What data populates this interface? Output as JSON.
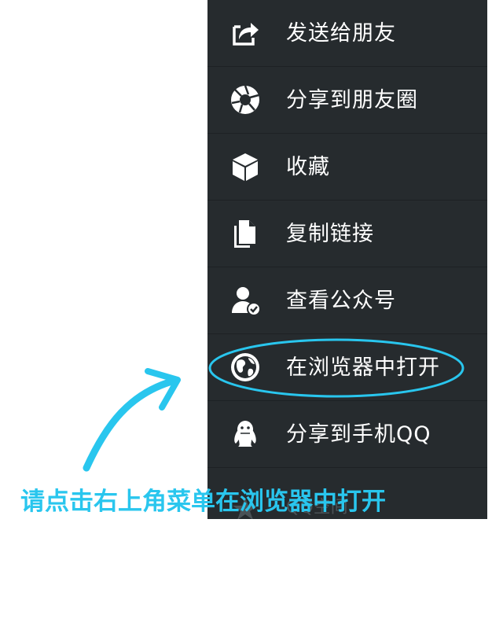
{
  "menu": {
    "items": [
      {
        "label": "发送给朋友",
        "icon": "share-arrow-icon"
      },
      {
        "label": "分享到朋友圈",
        "icon": "aperture-icon"
      },
      {
        "label": "收藏",
        "icon": "cube-icon"
      },
      {
        "label": "复制链接",
        "icon": "copy-document-icon"
      },
      {
        "label": "查看公众号",
        "icon": "person-check-icon"
      },
      {
        "label": "在浏览器中打开",
        "icon": "globe-icon"
      },
      {
        "label": "分享到手机QQ",
        "icon": "qq-penguin-icon"
      }
    ],
    "partial_item_label": "QQ空间"
  },
  "annotation": {
    "hint_text": "请点击右上角菜单在浏览器中打开",
    "highlight_color": "#29c6ee"
  },
  "colors": {
    "menu_background": "#262b2e",
    "menu_text": "#ffffff",
    "accent": "#29c6ee"
  }
}
